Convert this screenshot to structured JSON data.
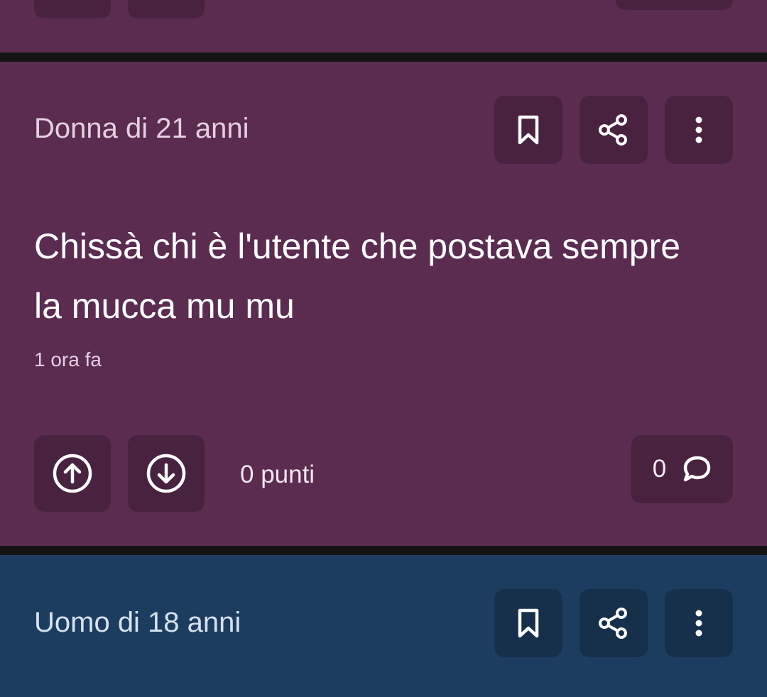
{
  "previous_post": {
    "bg_color": "#5b2c50"
  },
  "post": {
    "bg_color": "#5b2c50",
    "author": "Donna di 21 anni",
    "text": "Chissà chi è l'utente che postava sempre la mucca mu mu",
    "time": "1 ora fa",
    "points": "0 punti",
    "comments_count": "0",
    "icons": {
      "bookmark": "bookmark-icon",
      "share": "share-icon",
      "more": "more-vertical-icon",
      "upvote": "arrow-up-circle-icon",
      "downvote": "arrow-down-circle-icon",
      "comment": "comment-icon"
    }
  },
  "next_post": {
    "bg_color": "#1c3d5f",
    "author": "Uomo di 18 anni"
  }
}
